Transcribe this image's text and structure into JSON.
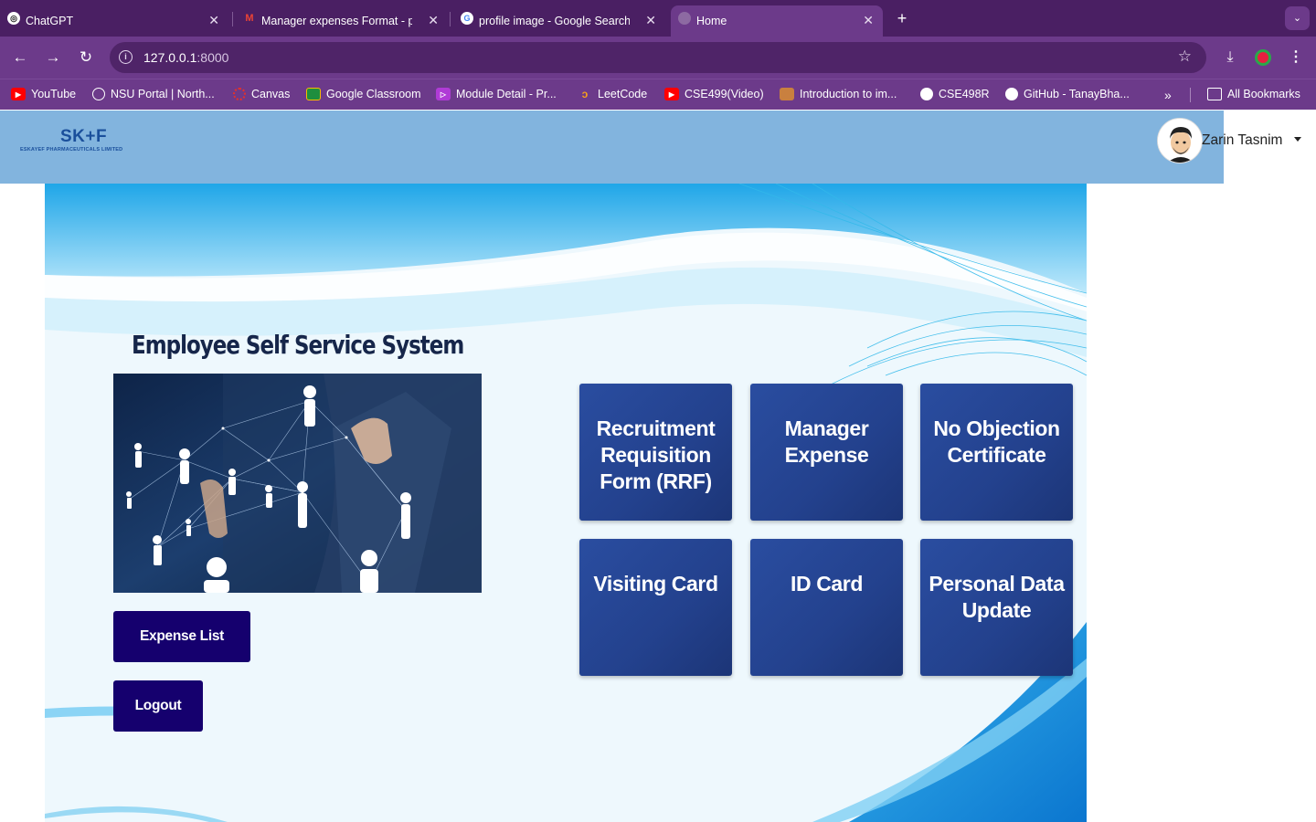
{
  "browser": {
    "tabs": [
      {
        "title": "ChatGPT",
        "icon": "chatgpt-icon"
      },
      {
        "title": "Manager expenses Format - p",
        "icon": "gmail-icon"
      },
      {
        "title": "profile image - Google Search",
        "icon": "google-icon"
      },
      {
        "title": "Home",
        "icon": "globe-icon",
        "active": true
      }
    ],
    "url_host": "127.0.0.1",
    "url_port": ":8000",
    "bookmarks": [
      {
        "label": "YouTube",
        "icon": "youtube-icon",
        "color": "#ff0000"
      },
      {
        "label": "NSU Portal | North...",
        "icon": "globe-icon",
        "color": "#ffffff"
      },
      {
        "label": "Canvas",
        "icon": "canvas-icon",
        "color": "#e4312b"
      },
      {
        "label": "Google Classroom",
        "icon": "classroom-icon",
        "color": "#1e8e3e"
      },
      {
        "label": "Module Detail - Pr...",
        "icon": "module-icon",
        "color": "#b03bd6"
      },
      {
        "label": "LeetCode",
        "icon": "leetcode-icon",
        "color": "#f89f1b"
      },
      {
        "label": "CSE499(Video)",
        "icon": "youtube-icon",
        "color": "#ff0000"
      },
      {
        "label": "Introduction to im...",
        "icon": "portrait-icon",
        "color": "#c9803f"
      },
      {
        "label": "CSE498R",
        "icon": "github-icon",
        "color": "#ffffff"
      },
      {
        "label": "GitHub - TanayBha...",
        "icon": "github-icon",
        "color": "#ffffff"
      }
    ],
    "all_bookmarks": "All Bookmarks"
  },
  "header": {
    "logo_mark": "SK+F",
    "logo_company": "ESKAYEF PHARMACEUTICALS LIMITED",
    "user_name": "Zarin Tasnim"
  },
  "main": {
    "title": "Employee Self Service System",
    "buttons": {
      "expense_list": "Expense List",
      "logout": "Logout"
    },
    "tiles": [
      "Recruitment Requisition Form (RRF)",
      "Manager Expense",
      "No Objection Certificate",
      "Visiting Card",
      "ID Card",
      "Personal Data Update"
    ]
  },
  "colors": {
    "tabstrip": "#4a1f63",
    "toolbar": "#6c3a8a",
    "header": "#82b4de",
    "tile": "#23418d",
    "dark_button": "#15006e",
    "title": "#16264a"
  }
}
